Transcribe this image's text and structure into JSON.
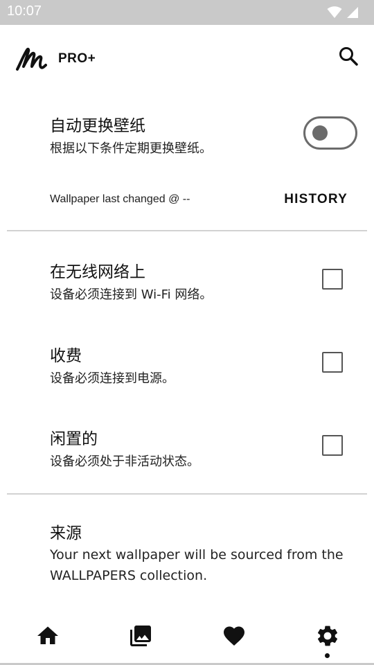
{
  "status_bar": {
    "time": "10:07",
    "icons": [
      "wifi-icon",
      "signal-icon"
    ]
  },
  "app_bar": {
    "brand": "PRO+",
    "logo": "wallpaper-logo",
    "search_icon": "search-icon"
  },
  "auto_change": {
    "title": "自动更换壁纸",
    "subtitle": "根据以下条件定期更换壁纸。",
    "enabled": false
  },
  "last_changed": {
    "text": "Wallpaper last changed @ --",
    "history_label": "HISTORY"
  },
  "conditions": [
    {
      "title": "在无线网络上",
      "subtitle": "设备必须连接到 Wi-Fi 网络。",
      "checked": false
    },
    {
      "title": "收费",
      "subtitle": "设备必须连接到电源。",
      "checked": false
    },
    {
      "title": "闲置的",
      "subtitle": "设备必须处于非活动状态。",
      "checked": false
    }
  ],
  "source": {
    "title": "来源",
    "description": "Your next wallpaper will be sourced from the WALLPAPERS collection."
  },
  "bottom_nav": {
    "items": [
      "home-icon",
      "gallery-icon",
      "heart-icon",
      "settings-icon"
    ],
    "active": "settings-icon"
  },
  "colors": {
    "status_bar": "#c9c9c9",
    "toggle": "#6b6b6b",
    "divider": "#d2d2d2"
  }
}
